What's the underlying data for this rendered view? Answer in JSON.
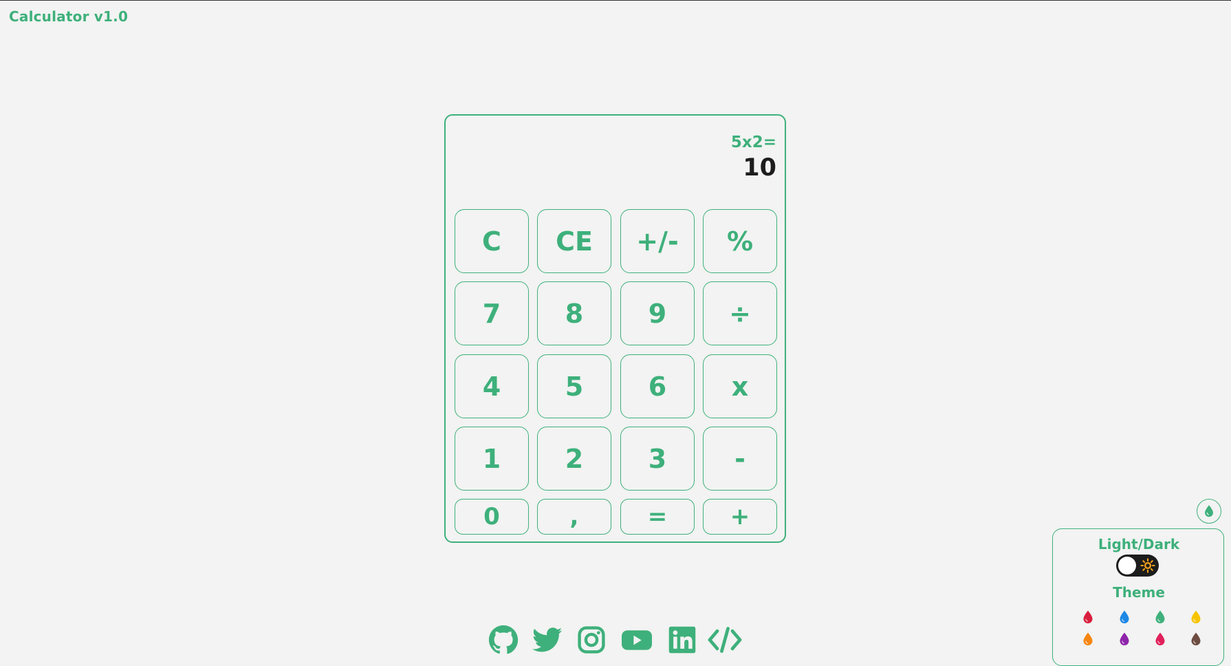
{
  "app": {
    "title": "Calculator v1.0"
  },
  "display": {
    "expression": "5x2=",
    "result": "10"
  },
  "keypad": {
    "rows": [
      [
        "C",
        "CE",
        "+/-",
        "%"
      ],
      [
        "7",
        "8",
        "9",
        "÷"
      ],
      [
        "4",
        "5",
        "6",
        "x"
      ],
      [
        "1",
        "2",
        "3",
        "-"
      ],
      [
        "0",
        ",",
        "=",
        "+"
      ]
    ]
  },
  "settings": {
    "mode_heading": "Light/Dark",
    "theme_heading": "Theme",
    "dark_mode": false,
    "toggle_icon": "droplet-icon",
    "theme_colors": [
      {
        "name": "red",
        "color": "#d81e3c"
      },
      {
        "name": "blue",
        "color": "#1e88e5"
      },
      {
        "name": "green",
        "color": "#3eb07b"
      },
      {
        "name": "yellow",
        "color": "#f6c400"
      },
      {
        "name": "orange",
        "color": "#f7860f"
      },
      {
        "name": "purple",
        "color": "#8e24aa"
      },
      {
        "name": "pink",
        "color": "#e0205a"
      },
      {
        "name": "brown",
        "color": "#6d4c41"
      }
    ]
  },
  "socials": [
    {
      "name": "github",
      "icon": "github-icon"
    },
    {
      "name": "twitter",
      "icon": "twitter-icon"
    },
    {
      "name": "instagram",
      "icon": "instagram-icon"
    },
    {
      "name": "youtube",
      "icon": "youtube-icon"
    },
    {
      "name": "linkedin",
      "icon": "linkedin-icon"
    },
    {
      "name": "code",
      "icon": "code-icon"
    }
  ],
  "colors": {
    "accent": "#3eb07b",
    "background": "#f2f3f2",
    "result_text": "#1d1d1d"
  }
}
